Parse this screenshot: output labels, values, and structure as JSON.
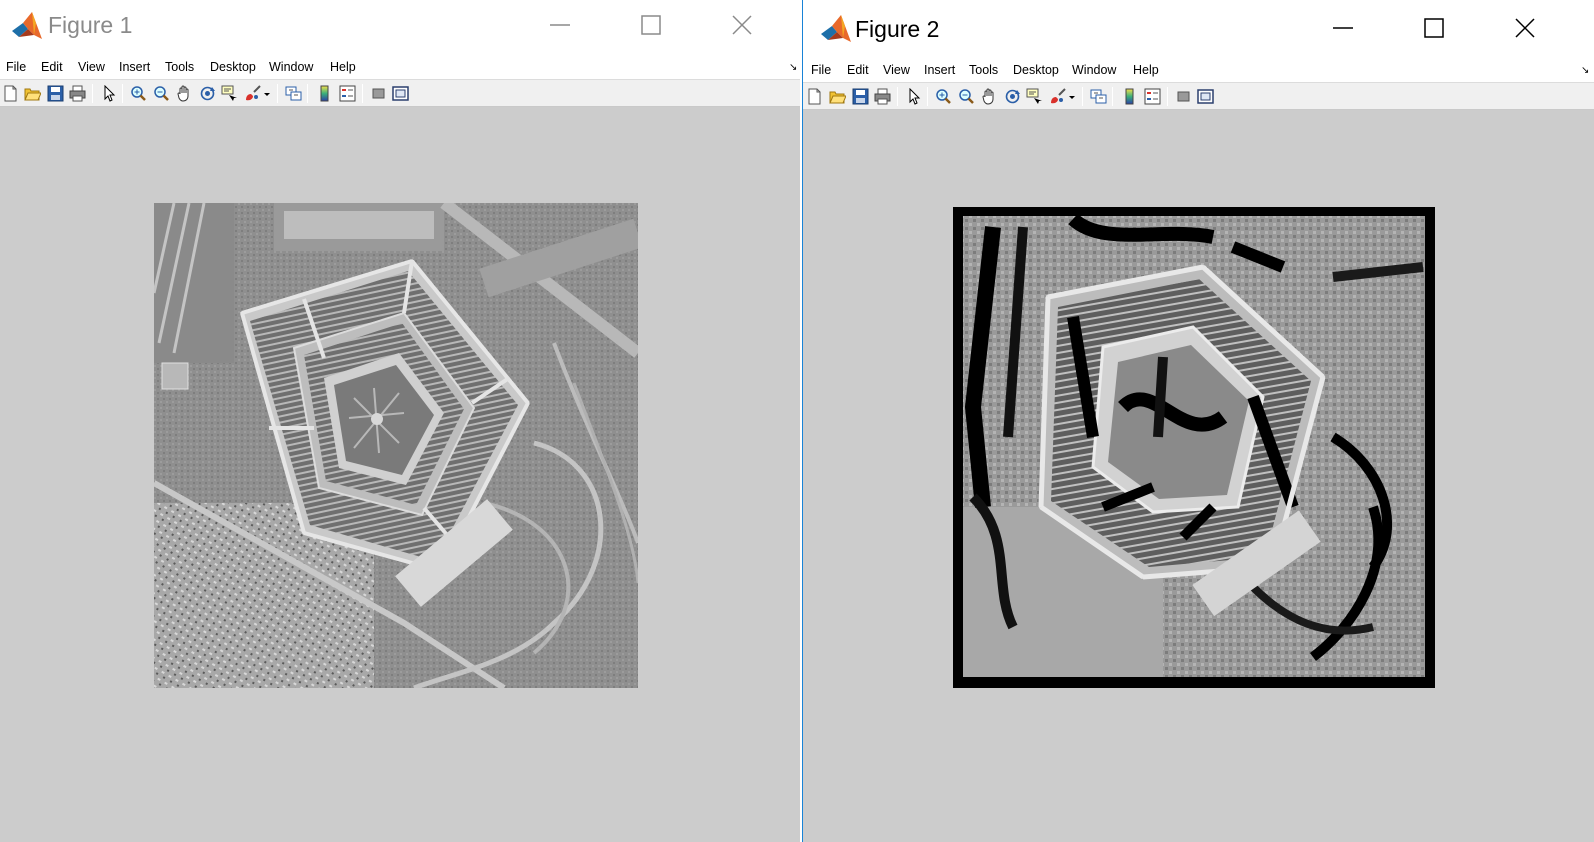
{
  "figures": [
    {
      "title": "Figure 1",
      "menu": [
        "File",
        "Edit",
        "View",
        "Insert",
        "Tools",
        "Desktop",
        "Window",
        "Help"
      ],
      "toolbar_icons": [
        "new-figure-icon",
        "open-file-icon",
        "save-icon",
        "print-icon",
        "edit-plot-icon",
        "zoom-in-icon",
        "zoom-out-icon",
        "pan-icon",
        "rotate-3d-icon",
        "data-cursor-icon",
        "brush-icon",
        "brush-dropdown-icon",
        "link-plot-icon",
        "colorbar-icon",
        "legend-icon",
        "hide-plot-tools-icon",
        "show-plot-tools-icon"
      ],
      "image": {
        "content": "grayscale aerial photograph of the Pentagon building",
        "style": "original"
      }
    },
    {
      "title": "Figure 2",
      "menu": [
        "File",
        "Edit",
        "View",
        "Insert",
        "Tools",
        "Desktop",
        "Window",
        "Help"
      ],
      "toolbar_icons": [
        "new-figure-icon",
        "open-file-icon",
        "save-icon",
        "print-icon",
        "edit-plot-icon",
        "zoom-in-icon",
        "zoom-out-icon",
        "pan-icon",
        "rotate-3d-icon",
        "data-cursor-icon",
        "brush-icon",
        "brush-dropdown-icon",
        "link-plot-icon",
        "colorbar-icon",
        "legend-icon",
        "hide-plot-tools-icon",
        "show-plot-tools-icon"
      ],
      "image": {
        "content": "filtered grayscale aerial photograph of the Pentagon with black border",
        "style": "filtered"
      }
    }
  ],
  "colors": {
    "figure_background": "#cccccc",
    "toolbar_background": "#f0f0f0",
    "active_window_border": "#1883d7",
    "inactive_title": "#8a8a8a"
  }
}
